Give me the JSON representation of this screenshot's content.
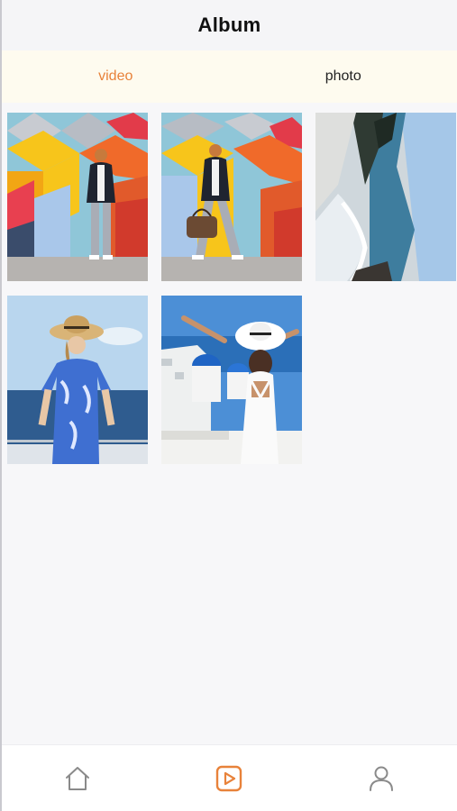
{
  "header": {
    "title": "Album"
  },
  "tabs": [
    {
      "label": "video",
      "active": true
    },
    {
      "label": "photo",
      "active": false
    }
  ],
  "album_items": [
    {
      "subject": "man in blazer against colorful geometric wall",
      "type": "video"
    },
    {
      "subject": "man walking with bag against colorful geometric wall",
      "type": "video"
    },
    {
      "subject": "rocky coastline with waves, rotated view",
      "type": "video"
    },
    {
      "subject": "woman in blue floral dress and straw hat by the sea",
      "type": "video"
    },
    {
      "subject": "woman in white dress and hat at Santorini",
      "type": "video"
    }
  ],
  "bottom_nav": [
    {
      "icon": "home-icon",
      "active": false
    },
    {
      "icon": "video-play-icon",
      "active": true
    },
    {
      "icon": "profile-icon",
      "active": false
    }
  ],
  "colors": {
    "accent": "#e8823a",
    "tab_bar_bg": "#fefbef",
    "header_bg": "#f5f5f7",
    "icon_inactive": "#8a8a8a"
  }
}
